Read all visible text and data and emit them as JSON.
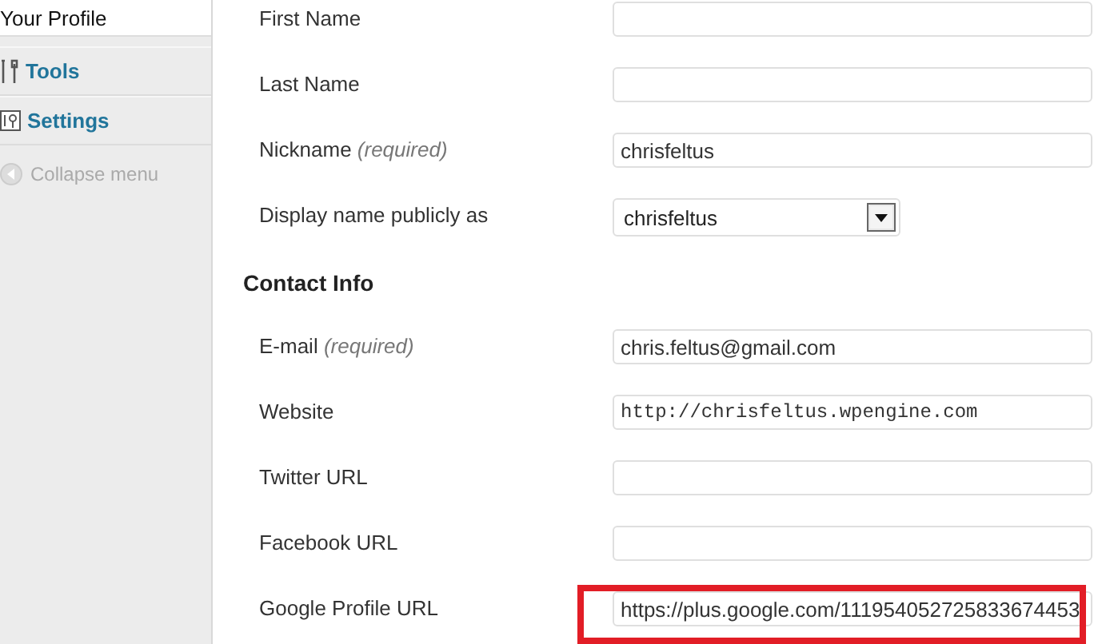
{
  "sidebar": {
    "items": [
      {
        "label": "Your Profile",
        "kind": "sub",
        "selected": true
      },
      {
        "label": "Tools",
        "kind": "tools",
        "selected": false
      },
      {
        "label": "Settings",
        "kind": "settings",
        "selected": false
      },
      {
        "label": "Collapse menu",
        "kind": "collapse",
        "selected": false
      }
    ]
  },
  "sections": [
    {
      "fields": [
        {
          "label": "First Name",
          "kind": "text"
        },
        {
          "label": "Last Name",
          "kind": "text"
        },
        {
          "label": "Nickname",
          "note": "(required)",
          "kind": "text",
          "value": "chrisfeltus"
        },
        {
          "label": "Display name publicly as",
          "kind": "select",
          "value": "chrisfeltus"
        }
      ]
    },
    {
      "heading": "Contact Info",
      "fields": [
        {
          "label": "E-mail",
          "note": "(required)",
          "kind": "text",
          "value": "chris.feltus@gmail.com"
        },
        {
          "label": "Website",
          "kind": "text",
          "monospace": true,
          "value": "http://chrisfeltus.wpengine.com"
        },
        {
          "label": "Twitter URL",
          "kind": "text"
        },
        {
          "label": "Facebook URL",
          "kind": "text"
        },
        {
          "label": "Google Profile URL",
          "kind": "text",
          "value": "https://plus.google.com/111954052725833674453",
          "highlighted": true
        }
      ]
    }
  ]
}
